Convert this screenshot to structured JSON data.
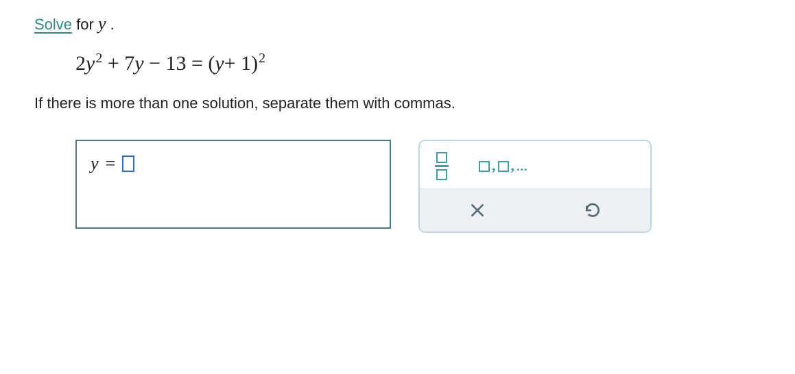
{
  "prompt": {
    "solve_link": "Solve",
    "for_text": " for ",
    "variable": "y",
    "period": " ."
  },
  "equation": {
    "lhs_coef": "2",
    "lhs_var": "y",
    "lhs_exp1": "2",
    "lhs_plus": "+ 7",
    "lhs_minus": "− 13",
    "eq_sign": "=",
    "rhs_open": "(",
    "rhs_var": "y",
    "rhs_plus": "+ 1",
    "rhs_close": ")",
    "rhs_exp": "2"
  },
  "prompt2": "If there is more than one solution, separate them with commas.",
  "answer": {
    "variable": "y",
    "equals": " = "
  },
  "icons": {
    "fraction": "fraction-icon",
    "list": "list-icon",
    "clear": "clear-icon",
    "undo": "undo-icon"
  },
  "list_text": {
    "comma1": ",",
    "comma2": ",",
    "dots": "..."
  }
}
